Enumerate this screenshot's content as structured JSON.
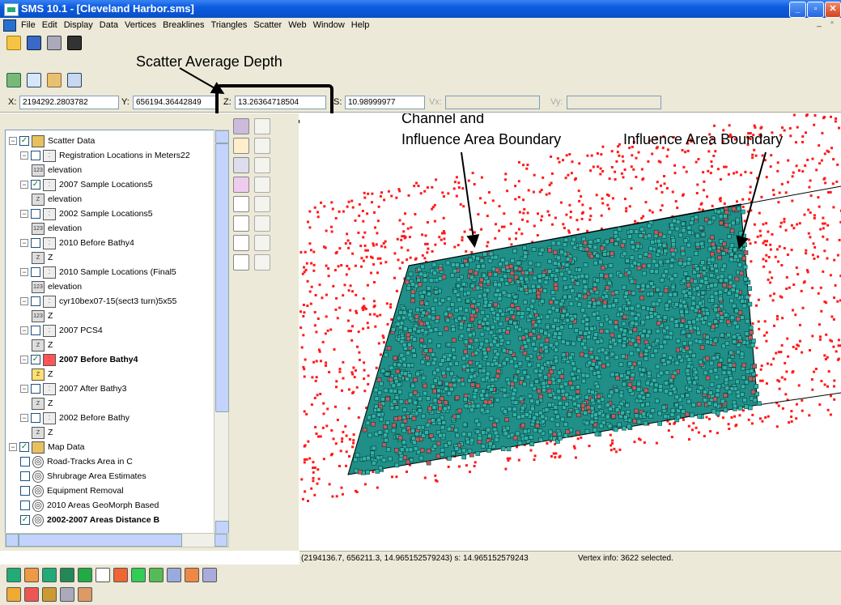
{
  "window": {
    "title": "SMS 10.1 - [Cleveland Harbor.sms]"
  },
  "menu": [
    "File",
    "Edit",
    "Display",
    "Data",
    "Vertices",
    "Breaklines",
    "Triangles",
    "Scatter",
    "Web",
    "Window",
    "Help"
  ],
  "coords": {
    "x_label": "X:",
    "x_value": "2194292.2803782",
    "y_label": "Y:",
    "y_value": "656194.36442849",
    "z_label": "Z:",
    "z_value": "13.26364718504",
    "s_label": "S:",
    "s_value": "10.98999977",
    "vx_label": "Vx:",
    "vy_label": "Vy:"
  },
  "annotations": {
    "scatter_avg": "Scatter Average Depth",
    "channel_line1": "Channel and",
    "channel_line2": "Influence Area Boundary",
    "influence": "Influence Area Boundary"
  },
  "tree": [
    {
      "indent": 0,
      "exp": "-",
      "check": "on",
      "icon": "folder",
      "label": "Scatter Data"
    },
    {
      "indent": 1,
      "exp": "-",
      "check": "off",
      "icon": "scatter",
      "label": "Registration Locations in Meters22"
    },
    {
      "indent": 2,
      "icon": "num",
      "label": "elevation"
    },
    {
      "indent": 1,
      "exp": "-",
      "check": "on",
      "icon": "scatter",
      "label": "2007 Sample Locations5"
    },
    {
      "indent": 2,
      "icon": "z",
      "label": "elevation"
    },
    {
      "indent": 1,
      "exp": "-",
      "check": "off",
      "icon": "scatter",
      "label": "2002 Sample Locations5"
    },
    {
      "indent": 2,
      "icon": "num",
      "label": "elevation"
    },
    {
      "indent": 1,
      "exp": "-",
      "check": "off",
      "icon": "scatter",
      "label": "2010 Before Bathy4"
    },
    {
      "indent": 2,
      "icon": "z",
      "label": "Z"
    },
    {
      "indent": 1,
      "exp": "-",
      "check": "off",
      "icon": "scatter",
      "label": "2010 Sample Locations (Final5"
    },
    {
      "indent": 2,
      "icon": "num",
      "label": "elevation"
    },
    {
      "indent": 1,
      "exp": "-",
      "check": "off",
      "icon": "scatter",
      "label": "cyr10bex07-15(sect3 turn)5x55"
    },
    {
      "indent": 2,
      "icon": "num",
      "label": "Z"
    },
    {
      "indent": 1,
      "exp": "-",
      "check": "off",
      "icon": "scatter",
      "label": "2007 PCS4"
    },
    {
      "indent": 2,
      "icon": "z",
      "label": "Z"
    },
    {
      "indent": 1,
      "exp": "-",
      "check": "on",
      "icon": "scatter-red",
      "label": "2007 Before Bathy4",
      "bold": true
    },
    {
      "indent": 2,
      "icon": "z-sel",
      "label": "Z"
    },
    {
      "indent": 1,
      "exp": "-",
      "check": "off",
      "icon": "scatter",
      "label": "2007 After Bathy3"
    },
    {
      "indent": 2,
      "icon": "z",
      "label": "Z"
    },
    {
      "indent": 1,
      "exp": "-",
      "check": "off",
      "icon": "scatter",
      "label": "2002 Before Bathy"
    },
    {
      "indent": 2,
      "icon": "z",
      "label": "Z"
    },
    {
      "indent": 0,
      "exp": "-",
      "check": "on",
      "icon": "mapfolder",
      "label": "Map Data"
    },
    {
      "indent": 1,
      "check": "off",
      "icon": "cov",
      "label": "Road-Tracks Area in C"
    },
    {
      "indent": 1,
      "check": "off",
      "icon": "cov",
      "label": "Shrubrage Area Estimates"
    },
    {
      "indent": 1,
      "check": "off",
      "icon": "cov",
      "label": "Equipment Removal"
    },
    {
      "indent": 1,
      "check": "off",
      "icon": "cov",
      "label": "2010 Areas GeoMorph Based"
    },
    {
      "indent": 1,
      "check": "on",
      "icon": "cov",
      "label": "2002-2007 Areas Distance B",
      "bold": true
    }
  ],
  "status": {
    "coords": "(2194136.7, 656211.3, 14.965152579243)  s: 14.965152579243",
    "vertex_info": "Vertex info: 3622 selected."
  },
  "colors": {
    "scatter_red": "#ff1a1a",
    "selected_teal": "#2fb3a8",
    "ui_face": "#ece9d8",
    "title_blue": "#0a58d8"
  }
}
